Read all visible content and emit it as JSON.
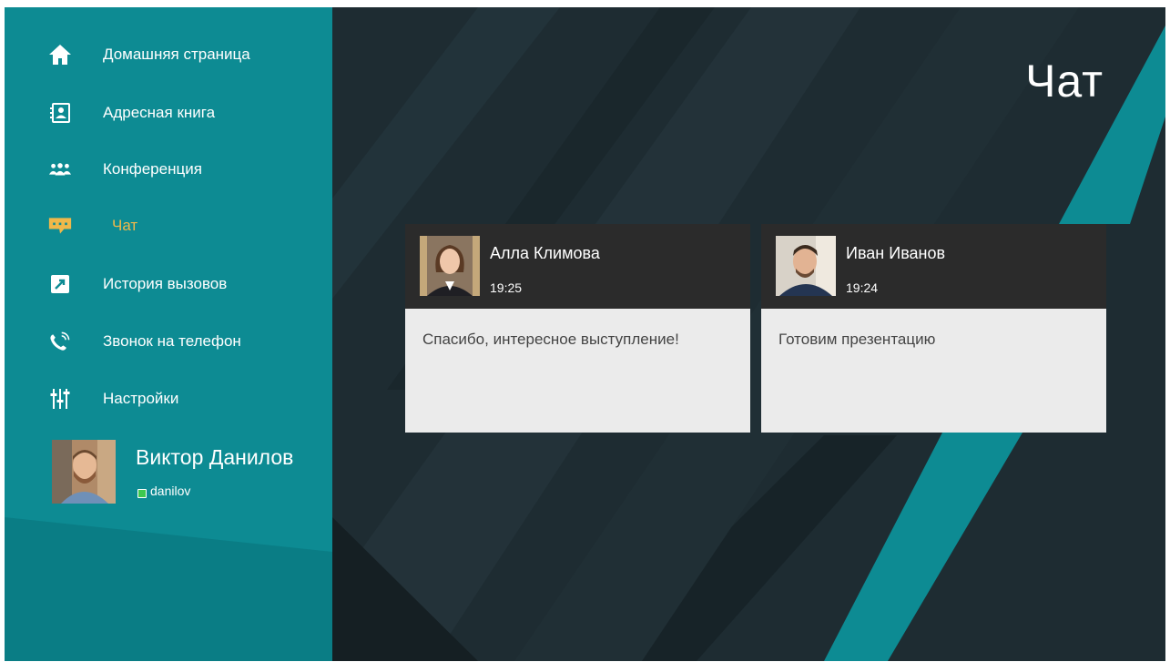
{
  "sidebar": {
    "items": [
      {
        "label": "Домашняя страница",
        "icon": "home-icon"
      },
      {
        "label": "Адресная книга",
        "icon": "contact-book-icon"
      },
      {
        "label": "Конференция",
        "icon": "group-icon"
      },
      {
        "label": "Чат",
        "icon": "chat-icon",
        "active": true
      },
      {
        "label": "История вызовов",
        "icon": "call-history-icon"
      },
      {
        "label": "Звонок на телефон",
        "icon": "phone-call-icon"
      },
      {
        "label": "Настройки",
        "icon": "settings-sliders-icon"
      }
    ],
    "user": {
      "name": "Виктор Данилов",
      "login": "danilov",
      "status_color": "#3ec84f"
    }
  },
  "main": {
    "title": "Чат",
    "chats": [
      {
        "name": "Алла Климова",
        "time": "19:25",
        "message": "Спасибо, интересное выступление!"
      },
      {
        "name": "Иван Иванов",
        "time": "19:24",
        "message": "Готовим презентацию"
      }
    ]
  },
  "colors": {
    "sidebar": "#0d8b93",
    "background": "#1c2a30",
    "accent": "#f0b84a",
    "card_header": "#2b2b2b",
    "card_body": "#ebebeb"
  }
}
